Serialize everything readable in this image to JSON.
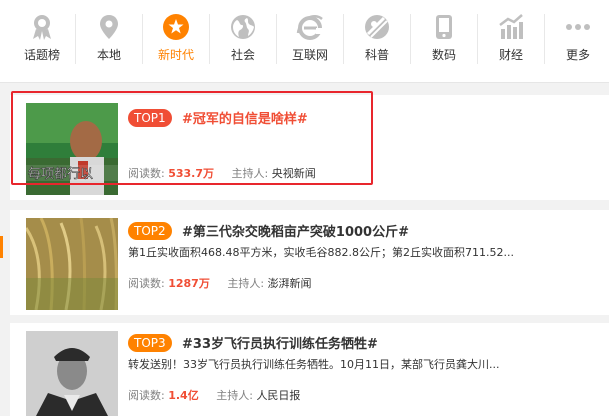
{
  "nav": [
    {
      "label": "话题榜",
      "icon": "medal-icon",
      "active": false
    },
    {
      "label": "本地",
      "icon": "location-pin-icon",
      "active": false
    },
    {
      "label": "新时代",
      "icon": "star-badge-icon",
      "active": true
    },
    {
      "label": "社会",
      "icon": "globe-icon",
      "active": false
    },
    {
      "label": "互联网",
      "icon": "internet-explorer-icon",
      "active": false
    },
    {
      "label": "科普",
      "icon": "planet-icon",
      "active": false
    },
    {
      "label": "数码",
      "icon": "phone-icon",
      "active": false
    },
    {
      "label": "财经",
      "icon": "finance-chart-icon",
      "active": false
    },
    {
      "label": "更多",
      "icon": "more-dots-icon",
      "active": false
    }
  ],
  "topics": [
    {
      "rank": "TOP1",
      "title": "#冠军的自信是啥样#",
      "desc": "",
      "reads_label": "阅读数:",
      "reads": "533.7万",
      "host_label": "主持人:",
      "host": "央视新闻",
      "thumb_caption": "每项都行以"
    },
    {
      "rank": "TOP2",
      "title": "#第三代杂交晚稻亩产突破1000公斤#",
      "desc": "第1丘实收面积468.48平方米，实收毛谷882.8公斤；第2丘实收面积711.52...",
      "reads_label": "阅读数:",
      "reads": "1287万",
      "host_label": "主持人:",
      "host": "澎湃新闻"
    },
    {
      "rank": "TOP3",
      "title": "#33岁飞行员执行训练任务牺牲#",
      "desc": "转发送别！33岁飞行员执行训练任务牺牲。10月11日，某部飞行员龚大川...",
      "reads_label": "阅读数:",
      "reads": "1.4亿",
      "host_label": "主持人:",
      "host": "人民日报"
    }
  ],
  "colors": {
    "accent": "#ff8200",
    "top1": "#f04e35",
    "highlight": "#e8262d"
  }
}
